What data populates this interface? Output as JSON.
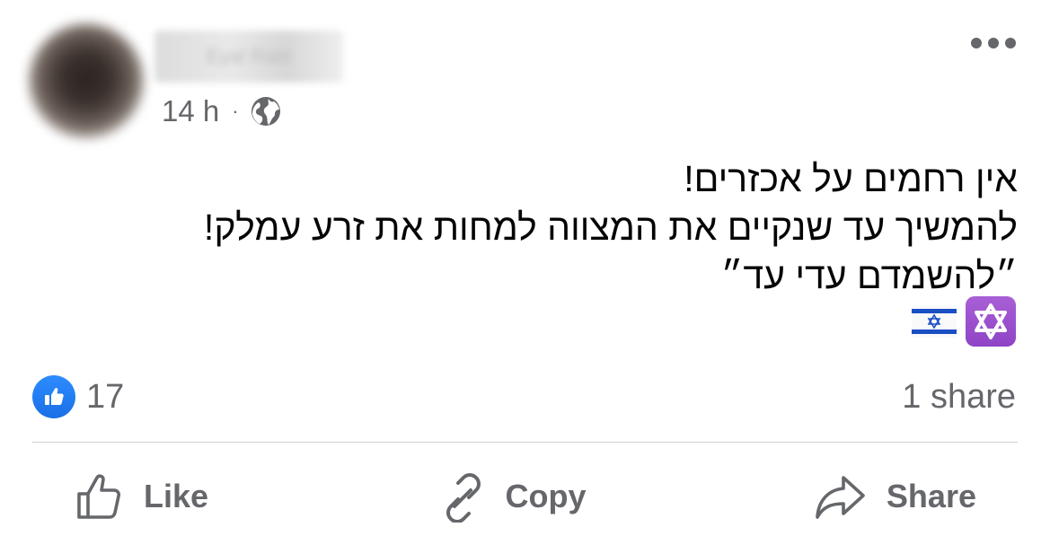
{
  "post": {
    "author_name": "Eyal Rabi",
    "timestamp": "14 h",
    "separator": "·",
    "audience_icon": "globe-icon",
    "more_icon": "more-options-icon",
    "text_lines": [
      "אין רחמים על אכזרים!",
      "להמשיך עד שנקיים את המצווה למחות את זרע עמלק!",
      "״להשמדם עדי עד״"
    ],
    "emojis": [
      "star-of-david-emoji",
      "israel-flag-emoji"
    ]
  },
  "stats": {
    "like_icon": "like-badge-icon",
    "like_count": "17",
    "share_count": "1 share"
  },
  "actions": {
    "like_label": "Like",
    "copy_label": "Copy",
    "share_label": "Share"
  },
  "colors": {
    "text": "#050505",
    "secondary_text": "#65676b",
    "facebook_blue": "#1877f2",
    "divider": "#ced0d4",
    "star_tile": "#8e44c5",
    "flag_blue": "#0038b8"
  }
}
